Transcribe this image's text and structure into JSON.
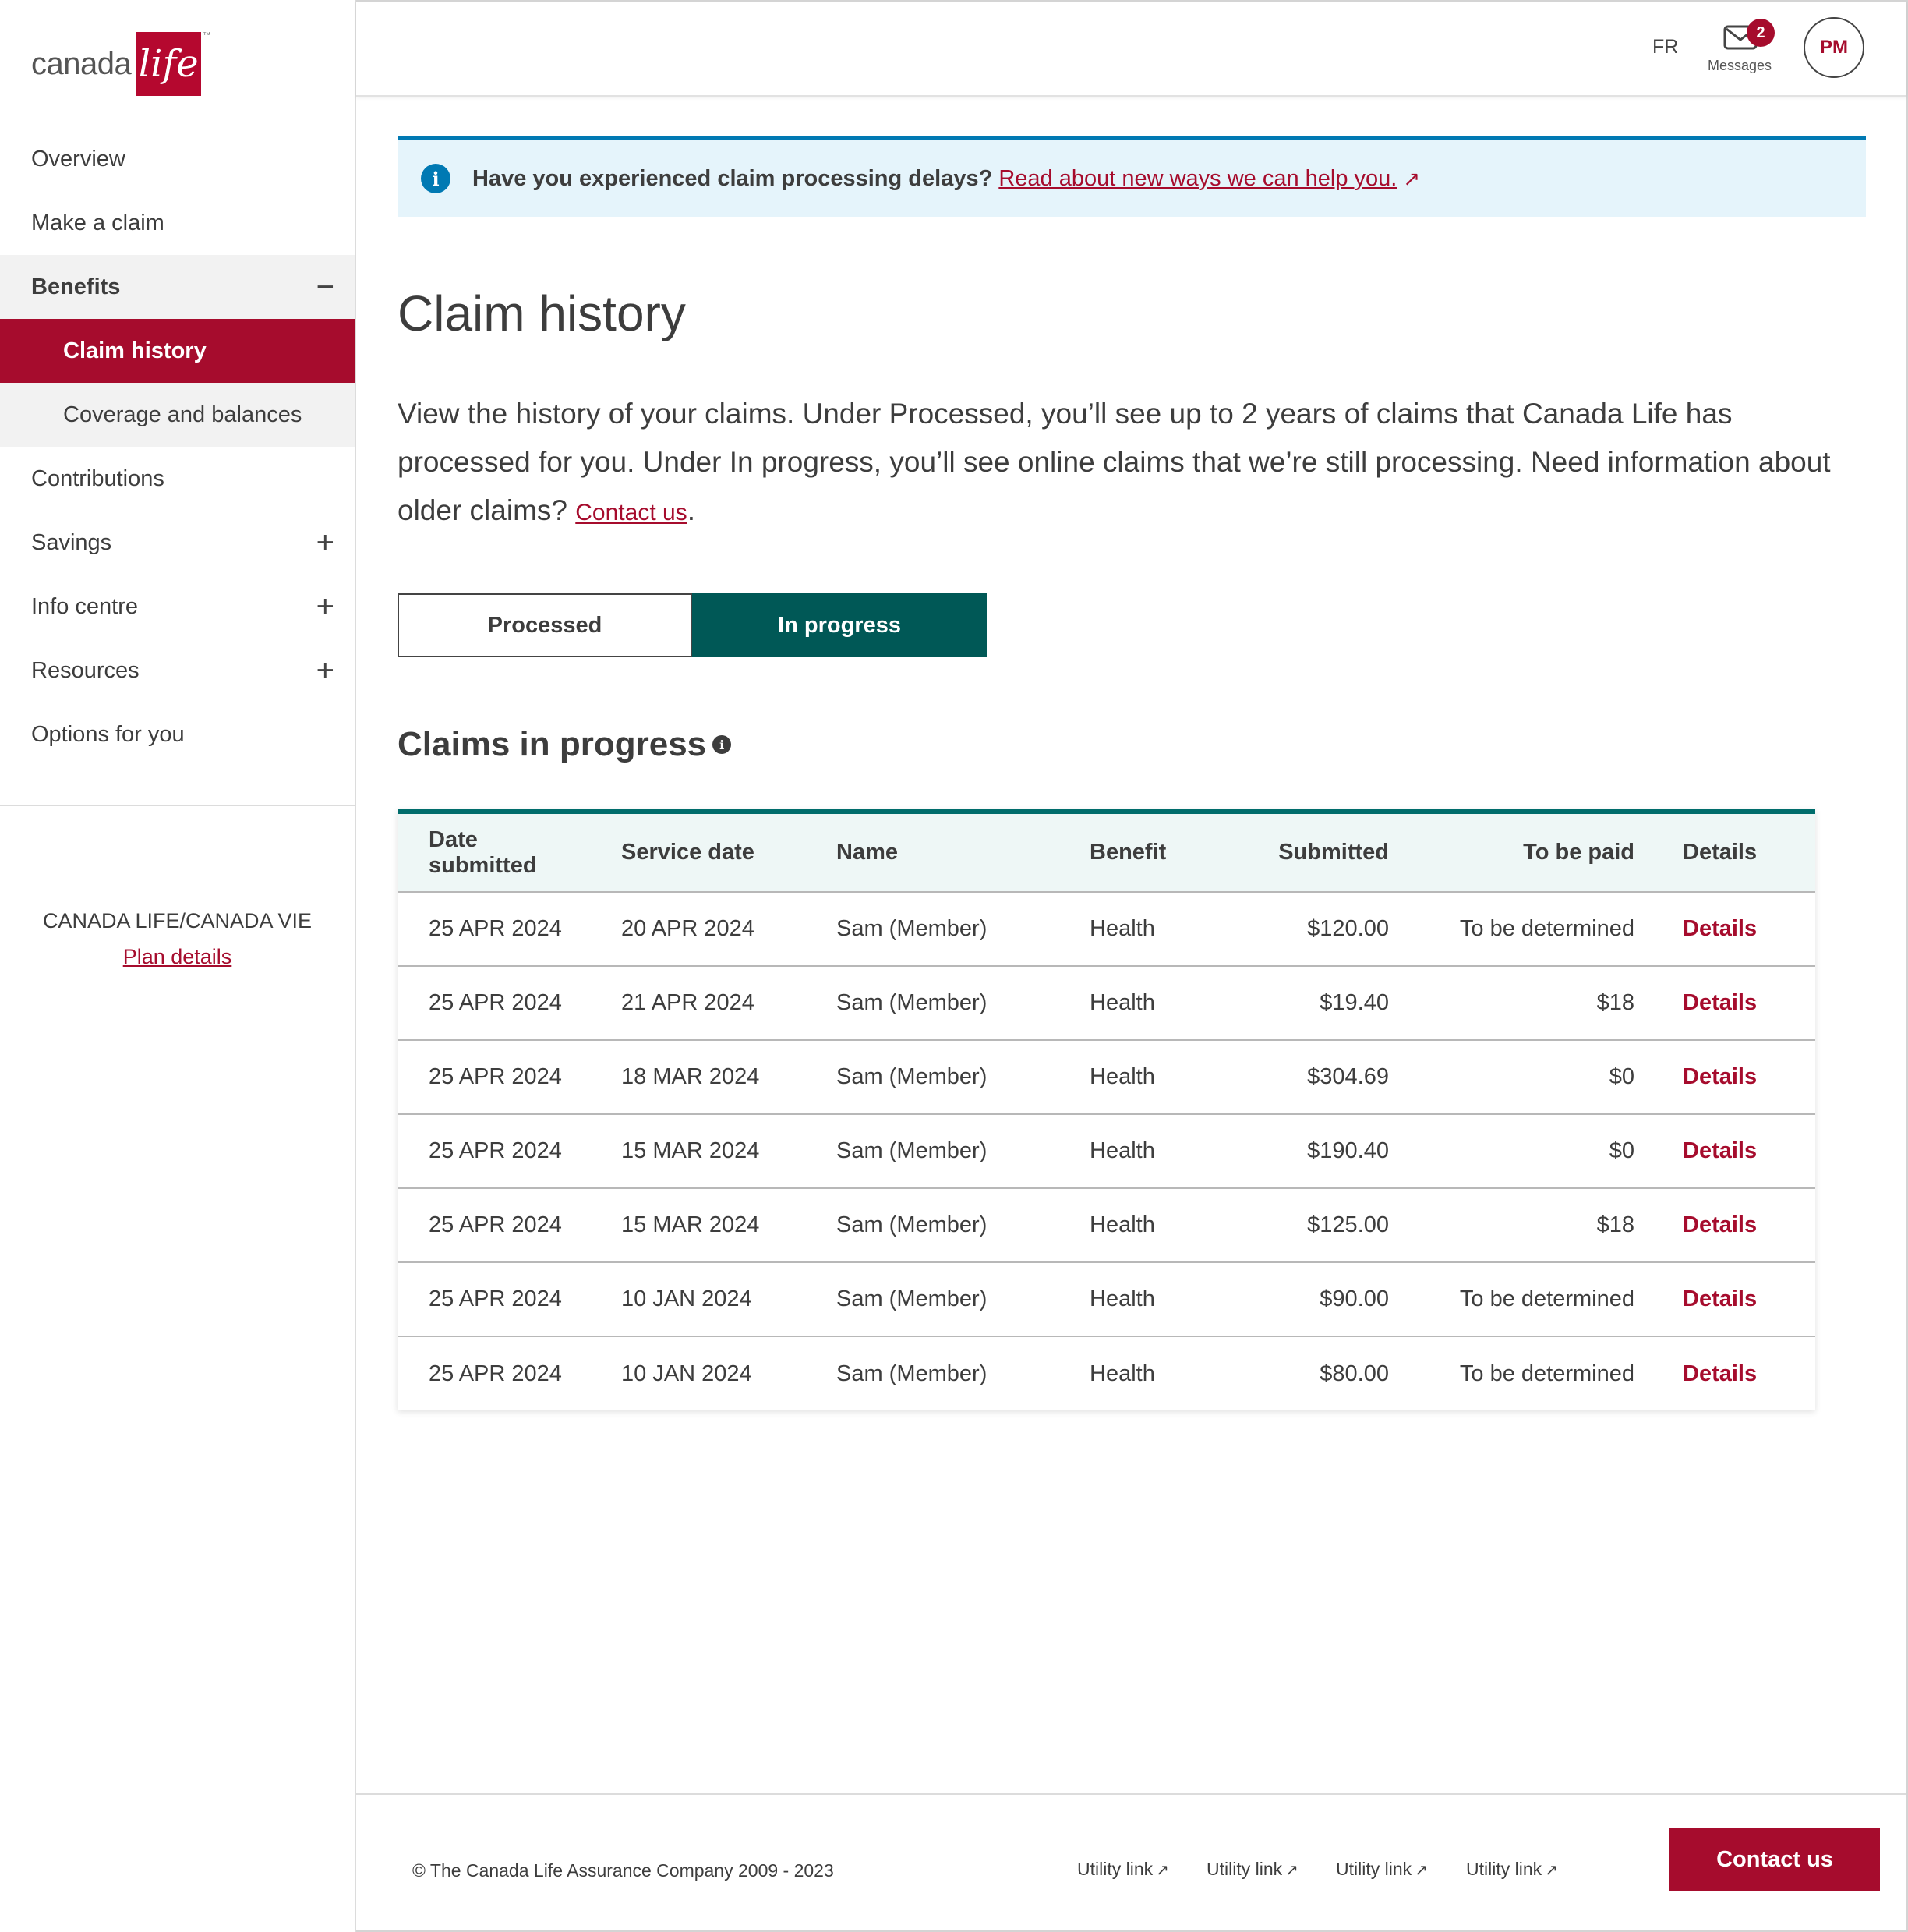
{
  "brand": {
    "logo_text": "canada",
    "logo_mark": "life",
    "logo_tm": "™",
    "accent_color": "#a60c2d",
    "teal_color": "#005856",
    "info_color": "#0079b3"
  },
  "sidebar": {
    "items": [
      {
        "label": "Overview"
      },
      {
        "label": "Make a claim"
      },
      {
        "label": "Benefits",
        "toggle": "−"
      },
      {
        "label": "Claim history"
      },
      {
        "label": "Coverage and balances"
      },
      {
        "label": "Contributions"
      },
      {
        "label": "Savings",
        "toggle": "+"
      },
      {
        "label": "Info centre",
        "toggle": "+"
      },
      {
        "label": "Resources",
        "toggle": "+"
      },
      {
        "label": "Options for you"
      }
    ],
    "plan_name": "CANADA LIFE/CANADA VIE",
    "plan_link": "Plan details"
  },
  "header": {
    "lang": "FR",
    "messages_label": "Messages",
    "messages_count": "2",
    "avatar_initials": "PM"
  },
  "banner": {
    "text": "Have you experienced claim processing delays?",
    "link": "Read about new ways we can help you.",
    "link_icon": "↗"
  },
  "page": {
    "title": "Claim history",
    "intro": "View the history of your claims. Under Processed, you’ll see up to 2 years of claims that Canada Life has processed for you. Under In progress, you’ll see online claims that we’re still processing. Need information about older claims?",
    "intro_link": "Contact us",
    "intro_end": "."
  },
  "tabs": {
    "processed": "Processed",
    "in_progress": "In progress",
    "selected": "In progress"
  },
  "section": {
    "title": "Claims in progress",
    "info_icon": "i"
  },
  "table": {
    "headers": [
      "Date submitted",
      "Service date",
      "Name",
      "Benefit",
      "Submitted",
      "To be paid",
      "Details"
    ],
    "rows": [
      [
        "25 APR 2024",
        "20 APR 2024",
        "Sam (Member)",
        "Health",
        "$120.00",
        "To be determined",
        "Details"
      ],
      [
        "25 APR 2024",
        "21 APR 2024",
        "Sam (Member)",
        "Health",
        "$19.40",
        "$18",
        "Details"
      ],
      [
        "25 APR 2024",
        "18 MAR 2024",
        "Sam (Member)",
        "Health",
        "$304.69",
        "$0",
        "Details"
      ],
      [
        "25 APR 2024",
        "15 MAR 2024",
        "Sam (Member)",
        "Health",
        "$190.40",
        "$0",
        "Details"
      ],
      [
        "25 APR 2024",
        "15 MAR 2024",
        "Sam (Member)",
        "Health",
        "$125.00",
        "$18",
        "Details"
      ],
      [
        "25 APR 2024",
        "10 JAN 2024",
        "Sam (Member)",
        "Health",
        "$90.00",
        "To be determined",
        "Details"
      ],
      [
        "25 APR 2024",
        "10 JAN 2024",
        "Sam (Member)",
        "Health",
        "$80.00",
        "To be determined",
        "Details"
      ]
    ]
  },
  "footer": {
    "copyright": "© The Canada Life Assurance Company 2009 - 2023",
    "links": [
      "Utility link",
      "Utility link",
      "Utility link",
      "Utility link"
    ],
    "link_icon": "↗",
    "contact_button": "Contact us"
  }
}
